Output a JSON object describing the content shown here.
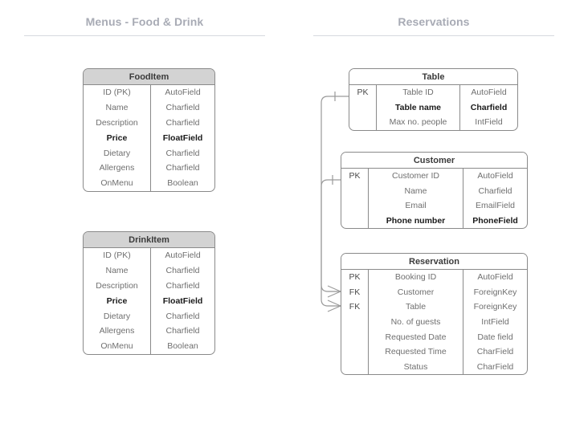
{
  "sections": {
    "menus": {
      "title": "Menus - Food & Drink"
    },
    "reservations": {
      "title": "Reservations"
    }
  },
  "entities": {
    "fooditem": {
      "title": "FoodItem",
      "rows": [
        {
          "name": "ID (PK)",
          "type": "AutoField",
          "bold": false
        },
        {
          "name": "Name",
          "type": "Charfield",
          "bold": false
        },
        {
          "name": "Description",
          "type": "Charfield",
          "bold": false
        },
        {
          "name": "Price",
          "type": "FloatField",
          "bold": true
        },
        {
          "name": "Dietary",
          "type": "Charfield",
          "bold": false
        },
        {
          "name": "Allergens",
          "type": "Charfield",
          "bold": false
        },
        {
          "name": "OnMenu",
          "type": "Boolean",
          "bold": false
        }
      ]
    },
    "drinkitem": {
      "title": "DrinkItem",
      "rows": [
        {
          "name": "ID (PK)",
          "type": "AutoField",
          "bold": false
        },
        {
          "name": "Name",
          "type": "Charfield",
          "bold": false
        },
        {
          "name": "Description",
          "type": "Charfield",
          "bold": false
        },
        {
          "name": "Price",
          "type": "FloatField",
          "bold": true
        },
        {
          "name": "Dietary",
          "type": "Charfield",
          "bold": false
        },
        {
          "name": "Allergens",
          "type": "Charfield",
          "bold": false
        },
        {
          "name": "OnMenu",
          "type": "Boolean",
          "bold": false
        }
      ]
    },
    "table": {
      "title": "Table",
      "rows": [
        {
          "key": "PK",
          "name": "Table ID",
          "type": "AutoField",
          "bold": false
        },
        {
          "key": "",
          "name": "Table name",
          "type": "Charfield",
          "bold": true
        },
        {
          "key": "",
          "name": "Max no. people",
          "type": "IntField",
          "bold": false
        }
      ]
    },
    "customer": {
      "title": "Customer",
      "rows": [
        {
          "key": "PK",
          "name": "Customer ID",
          "type": "AutoField",
          "bold": false
        },
        {
          "key": "",
          "name": "Name",
          "type": "Charfield",
          "bold": false
        },
        {
          "key": "",
          "name": "Email",
          "type": "EmailField",
          "bold": false
        },
        {
          "key": "",
          "name": "Phone number",
          "type": "PhoneField",
          "bold": true
        }
      ]
    },
    "reservation": {
      "title": "Reservation",
      "rows": [
        {
          "key": "PK",
          "name": "Booking ID",
          "type": "AutoField",
          "bold": false
        },
        {
          "key": "FK",
          "name": "Customer",
          "type": "ForeignKey",
          "bold": false
        },
        {
          "key": "FK",
          "name": "Table",
          "type": "ForeignKey",
          "bold": false
        },
        {
          "key": "",
          "name": "No. of guests",
          "type": "IntField",
          "bold": false
        },
        {
          "key": "",
          "name": "Requested Date",
          "type": "Date field",
          "bold": false
        },
        {
          "key": "",
          "name": "Requested Time",
          "type": "CharField",
          "bold": false
        },
        {
          "key": "",
          "name": "Status",
          "type": "CharField",
          "bold": false
        }
      ]
    }
  },
  "relationships": [
    {
      "from": "table",
      "to": "reservation",
      "from_cardinality": "one",
      "to_cardinality": "many"
    },
    {
      "from": "customer",
      "to": "reservation",
      "from_cardinality": "one",
      "to_cardinality": "many"
    }
  ],
  "colors": {
    "title_text": "#a8abb5",
    "rule": "#d6d9de",
    "entity_border": "#8a8a8a",
    "menu_header_fill": "#d3d3d3",
    "text_normal": "#6f6f6f",
    "text_bold": "#1a1a1a",
    "connector": "#9a9a9a",
    "background": "#ffffff"
  }
}
